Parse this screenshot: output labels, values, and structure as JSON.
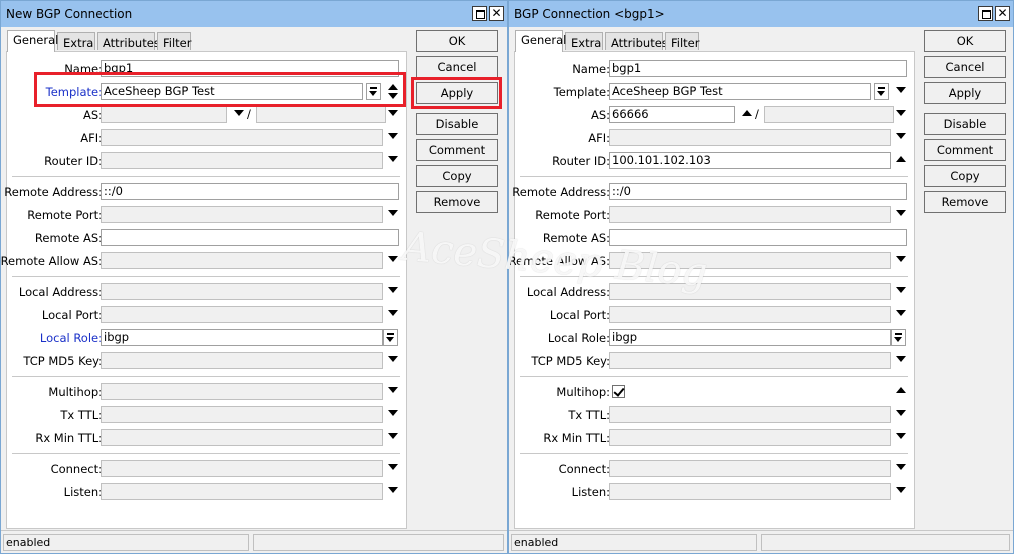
{
  "window1": {
    "title": "New BGP Connection",
    "tabs": [
      "General",
      "Extra",
      "Attributes",
      "Filter"
    ],
    "fields": {
      "name": {
        "label": "Name:",
        "value": "bgp1"
      },
      "template": {
        "label": "Template:",
        "value": "AceSheep BGP Test"
      },
      "as": {
        "label": "AS:",
        "value": ""
      },
      "afi": {
        "label": "AFI:",
        "value": ""
      },
      "router_id": {
        "label": "Router ID:",
        "value": ""
      },
      "remote_address": {
        "label": "Remote Address:",
        "value": "::/0"
      },
      "remote_port": {
        "label": "Remote Port:",
        "value": ""
      },
      "remote_as": {
        "label": "Remote AS:",
        "value": ""
      },
      "remote_allow_as": {
        "label": "Remote Allow AS:",
        "value": ""
      },
      "local_address": {
        "label": "Local Address:",
        "value": ""
      },
      "local_port": {
        "label": "Local Port:",
        "value": ""
      },
      "local_role": {
        "label": "Local Role:",
        "value": "ibgp"
      },
      "tcp_md5_key": {
        "label": "TCP MD5 Key:",
        "value": ""
      },
      "multihop": {
        "label": "Multihop:",
        "value": ""
      },
      "tx_ttl": {
        "label": "Tx TTL:",
        "value": ""
      },
      "rx_min_ttl": {
        "label": "Rx Min TTL:",
        "value": ""
      },
      "connect": {
        "label": "Connect:",
        "value": ""
      },
      "listen": {
        "label": "Listen:",
        "value": ""
      }
    },
    "as_separator": "/",
    "buttons": [
      "OK",
      "Cancel",
      "Apply",
      "Disable",
      "Comment",
      "Copy",
      "Remove"
    ],
    "status": "enabled"
  },
  "window2": {
    "title": "BGP Connection <bgp1>",
    "tabs": [
      "General",
      "Extra",
      "Attributes",
      "Filter"
    ],
    "fields": {
      "name": {
        "label": "Name:",
        "value": "bgp1"
      },
      "template": {
        "label": "Template:",
        "value": "AceSheep BGP Test"
      },
      "as": {
        "label": "AS:",
        "value": "66666"
      },
      "afi": {
        "label": "AFI:",
        "value": ""
      },
      "router_id": {
        "label": "Router ID:",
        "value": "100.101.102.103"
      },
      "remote_address": {
        "label": "Remote Address:",
        "value": "::/0"
      },
      "remote_port": {
        "label": "Remote Port:",
        "value": ""
      },
      "remote_as": {
        "label": "Remote AS:",
        "value": ""
      },
      "remote_allow_as": {
        "label": "Remote Allow AS:",
        "value": ""
      },
      "local_address": {
        "label": "Local Address:",
        "value": ""
      },
      "local_port": {
        "label": "Local Port:",
        "value": ""
      },
      "local_role": {
        "label": "Local Role:",
        "value": "ibgp"
      },
      "tcp_md5_key": {
        "label": "TCP MD5 Key:",
        "value": ""
      },
      "multihop": {
        "label": "Multihop:",
        "checked": true
      },
      "tx_ttl": {
        "label": "Tx TTL:",
        "value": ""
      },
      "rx_min_ttl": {
        "label": "Rx Min TTL:",
        "value": ""
      },
      "connect": {
        "label": "Connect:",
        "value": ""
      },
      "listen": {
        "label": "Listen:",
        "value": ""
      }
    },
    "as_separator": "/",
    "buttons": [
      "OK",
      "Cancel",
      "Apply",
      "Disable",
      "Comment",
      "Copy",
      "Remove"
    ],
    "status": "enabled"
  },
  "watermark": "AceSheep Blog",
  "colors": {
    "titlebar": "#98c2ee",
    "highlight": "#e8202a",
    "link_label": "#1a30c8"
  }
}
